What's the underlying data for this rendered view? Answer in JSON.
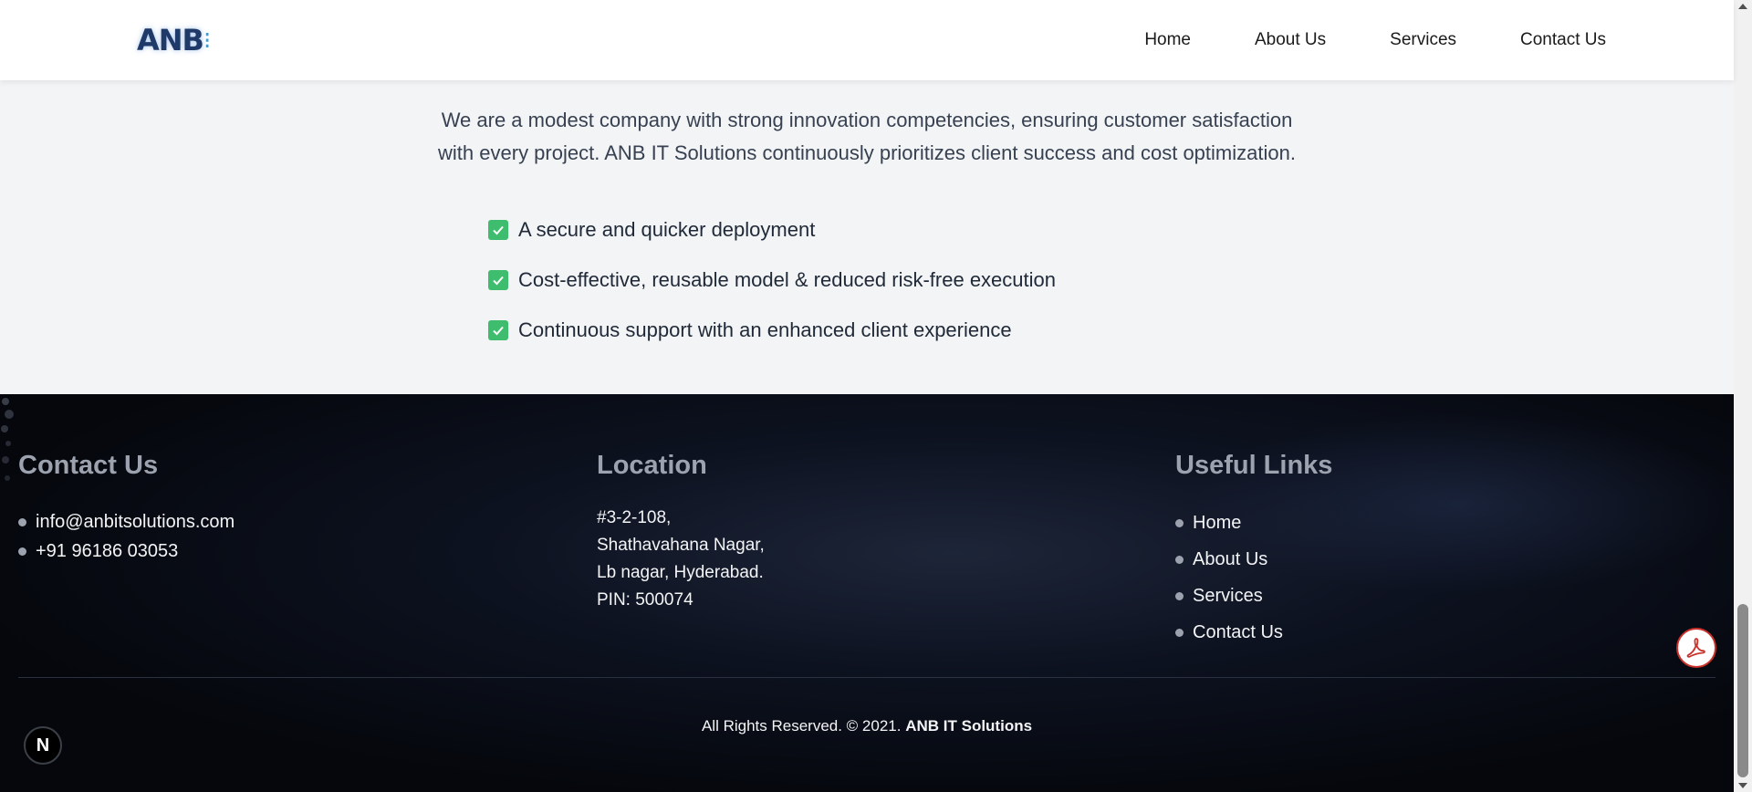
{
  "header": {
    "logo": "ANB",
    "nav": [
      "Home",
      "About Us",
      "Services",
      "Contact Us"
    ]
  },
  "intro": {
    "paragraph_line1": "We are a modest company with strong innovation competencies, ensuring customer satisfaction",
    "paragraph_line2": "with every project. ANB IT Solutions continuously prioritizes client success and cost optimization.",
    "checklist": [
      "A secure and quicker deployment",
      "Cost-effective, reusable model & reduced risk-free execution",
      "Continuous support with an enhanced client experience"
    ]
  },
  "footer": {
    "contact": {
      "title": "Contact Us",
      "email": "info@anbitsolutions.com",
      "phone": "+91 96186 03053"
    },
    "location": {
      "title": "Location",
      "lines": [
        "#3-2-108,",
        "Shathavahana Nagar,",
        "Lb nagar, Hyderabad.",
        "PIN: 500074"
      ]
    },
    "useful_links": {
      "title": "Useful Links",
      "items": [
        "Home",
        "About Us",
        "Services",
        "Contact Us"
      ]
    },
    "copyright_prefix": "All Rights Reserved. © 2021.",
    "copyright_company": "ANB IT Solutions",
    "badge_letter": "N"
  },
  "colors": {
    "check_green": "#3ebd6e",
    "footer_bg": "#05070c",
    "pdf_red": "#c9312a"
  },
  "icons": [
    "check-icon",
    "pdf-icon",
    "next-badge-icon",
    "bullet-dot-icon"
  ]
}
